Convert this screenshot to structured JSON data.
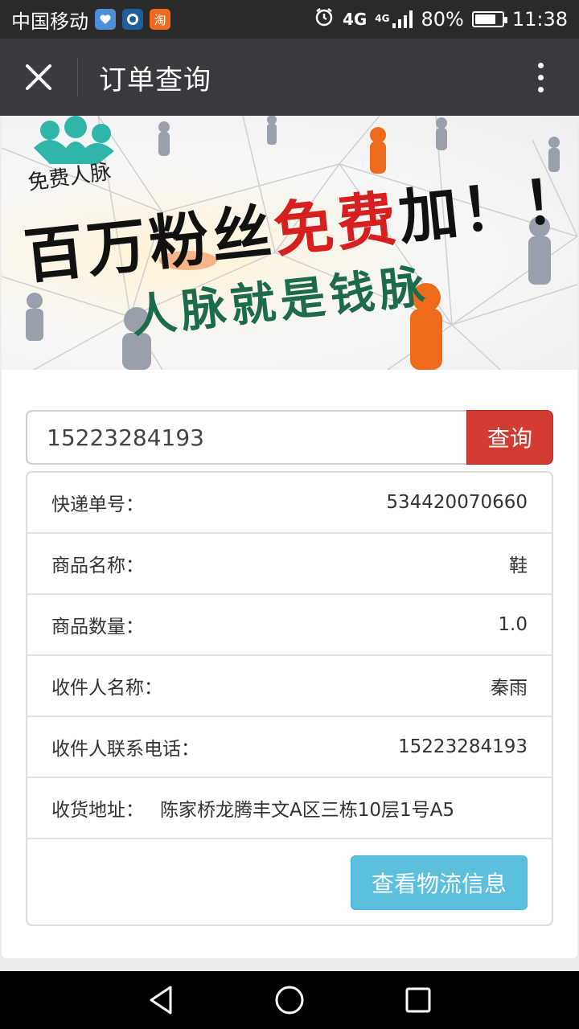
{
  "status_bar": {
    "carrier": "中国移动",
    "app_icons": [
      "health-app-icon",
      "chat-app-icon",
      "taobao-icon"
    ],
    "taobao_glyph": "淘",
    "network": "4G",
    "network_small": "4G",
    "battery_percent": "80%",
    "battery_level": 0.8,
    "time": "11:38"
  },
  "title_bar": {
    "title": "订单查询"
  },
  "banner": {
    "logo_text": "免费人脉",
    "line1_part1": "百万粉丝",
    "line1_red": "免费",
    "line1_part2": "加！！",
    "line2": "人脉就是钱脉"
  },
  "search": {
    "value": "15223284193",
    "button_label": "查询"
  },
  "order": {
    "rows": [
      {
        "label": "快递单号：",
        "value": "534420070660"
      },
      {
        "label": "商品名称：",
        "value": "鞋"
      },
      {
        "label": "商品数量：",
        "value": "1.0"
      },
      {
        "label": "收件人名称：",
        "value": "秦雨"
      },
      {
        "label": "收件人联系电话：",
        "value": "15223284193"
      },
      {
        "label": "收货地址：",
        "value": "陈家桥龙腾丰文A区三栋10层1号A5"
      }
    ],
    "logistics_button": "查看物流信息"
  },
  "colors": {
    "search_button": "#d23a32",
    "logistics_button": "#5bc0de",
    "title_bar": "#393a3e"
  }
}
